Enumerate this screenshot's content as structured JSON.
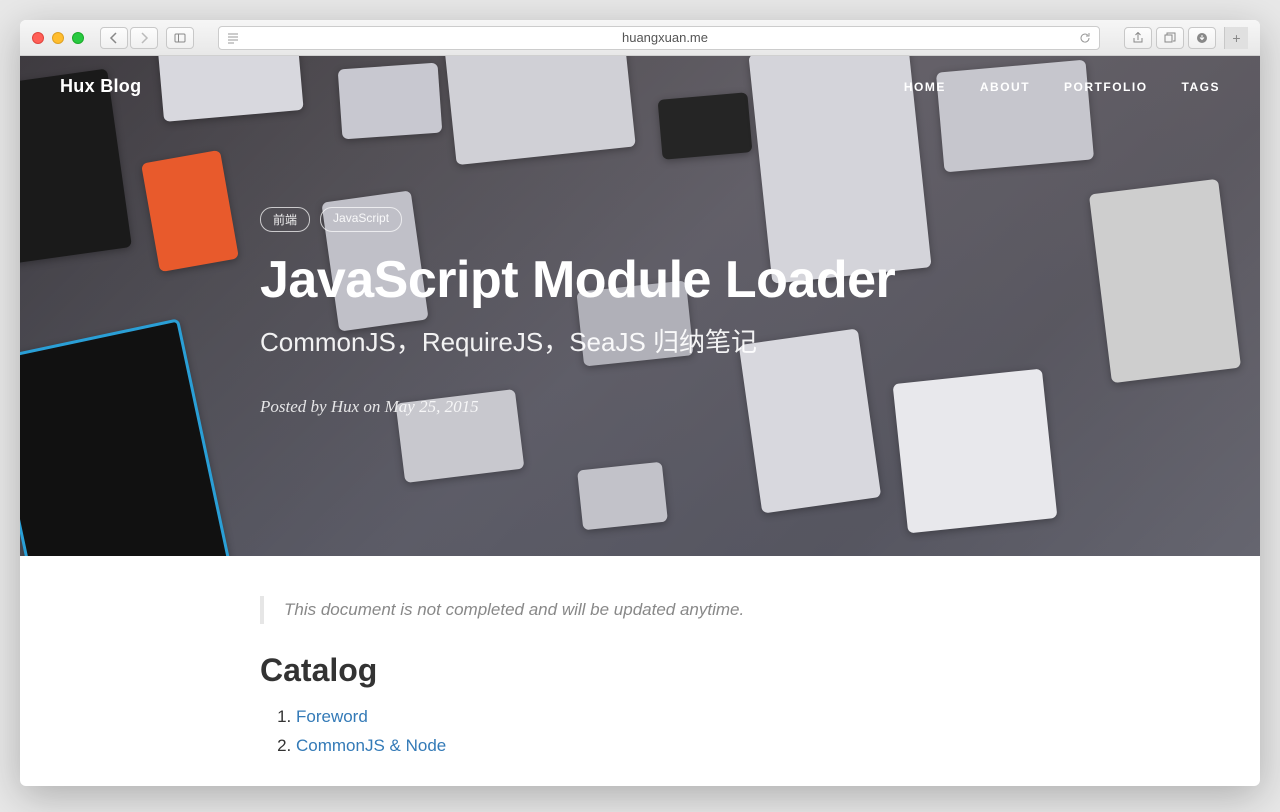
{
  "browser": {
    "url": "huangxuan.me"
  },
  "navbar": {
    "brand": "Hux Blog",
    "links": [
      "HOME",
      "ABOUT",
      "PORTFOLIO",
      "TAGS"
    ]
  },
  "hero": {
    "tags": [
      "前端",
      "JavaScript"
    ],
    "title": "JavaScript Module Loader",
    "subtitle": "CommonJS，RequireJS，SeaJS 归纳笔记",
    "meta": "Posted by Hux on May 25, 2015"
  },
  "article": {
    "note": "This document is not completed and will be updated anytime.",
    "catalog_heading": "Catalog",
    "catalog": [
      "Foreword",
      "CommonJS & Node"
    ]
  }
}
